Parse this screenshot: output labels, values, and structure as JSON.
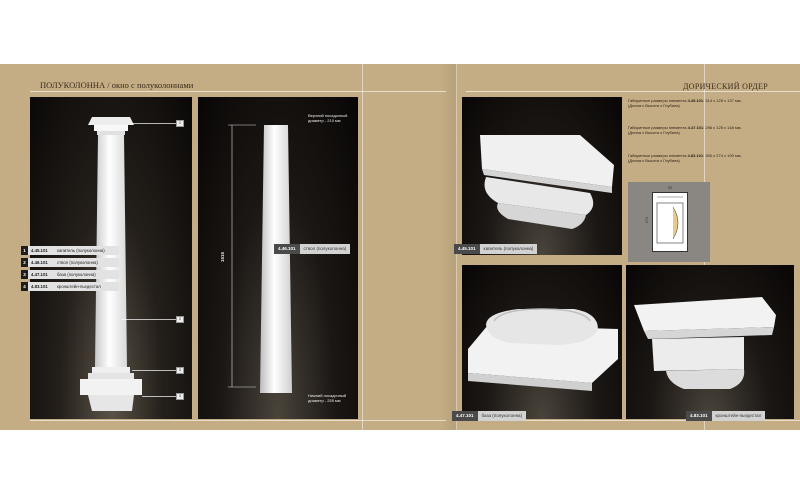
{
  "left_page": {
    "title": "ПОЛУКОЛОННА / окно с полуколоннами",
    "legend": [
      {
        "num": "1",
        "code": "4.45.101",
        "name": "капитель (полуколонна)"
      },
      {
        "num": "2",
        "code": "4.46.101",
        "name": "ствол (полуколонна)"
      },
      {
        "num": "3",
        "code": "4.47.101",
        "name": "база (полуколонна)"
      },
      {
        "num": "4",
        "code": "4.83.101",
        "name": "кронштейн-пьедестал"
      }
    ],
    "callouts": [
      "1",
      "2",
      "3",
      "4"
    ],
    "shaft_panel": {
      "top_diameter": "Верхний посадочный диаметр - 210 мм",
      "bottom_diameter": "Нижний посадочный диаметр - 255 мм",
      "height": "1515",
      "label_code": "4.46.101",
      "label_name": "ствол (полуколонна)"
    }
  },
  "right_page": {
    "title": "ДОРИЧЕСКИЙ ОРДЕР",
    "capital_label": {
      "code": "4.45.101",
      "name": "капитель (полуколонна)"
    },
    "base_label": {
      "code": "4.47.101",
      "name": "база (полуколонна)"
    },
    "bracket_label": {
      "code": "4.83.101",
      "name": "кронштейн-пьедестал"
    },
    "specs": [
      {
        "prefix": "Габаритные размеры элемента",
        "code": "4.45.101",
        "dims": ": 314 x 125 x 137 мм.",
        "note": "(Длина x Высота x Глубина)"
      },
      {
        "prefix": "Габаритные размеры элемента",
        "code": "4.47.101",
        "dims": ": 296 x 125 x 148 мм.",
        "note": "(Длина x Высота x Глубина)"
      },
      {
        "prefix": "Габаритные размеры элемента",
        "code": "4.83.101",
        "dims": ": 300 x 274 x 190 мм.",
        "note": "(Длина x Высота x Глубина)"
      }
    ],
    "drawing": {
      "width_dim": "92",
      "height_dim": "274"
    }
  }
}
